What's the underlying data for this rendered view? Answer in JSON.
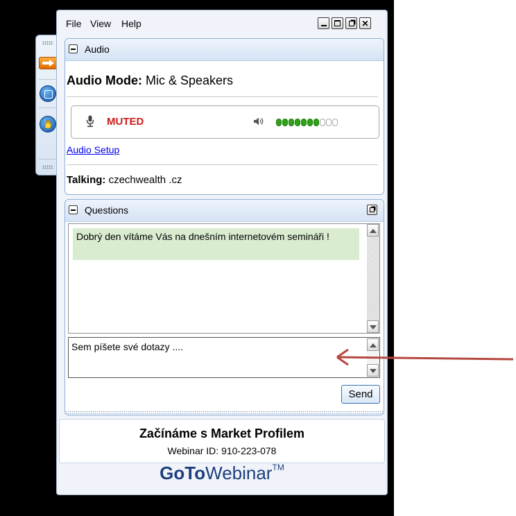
{
  "menu": {
    "file": "File",
    "view": "View",
    "help": "Help"
  },
  "audio": {
    "header": "Audio",
    "mode_label": "Audio Mode:",
    "mode_value": "Mic & Speakers",
    "mic_status": "MUTED",
    "speaker_level": 0.7,
    "speaker_dots_total": 10,
    "setup_link": "Audio Setup",
    "talking_label": "Talking:",
    "talking_value": "czechwealth .cz"
  },
  "questions": {
    "header": "Questions",
    "message": "Dobrý den vítáme Vás na dnešním internetovém semináři !",
    "input_value": "Sem píšete své dotazy ....",
    "send_label": "Send"
  },
  "webinar": {
    "title": "Začínáme s Market Profilem",
    "id_text": "Webinar ID: 910-223-078",
    "logo_bold": "GoTo",
    "logo_rest": "Webinar",
    "logo_tm": "TM"
  },
  "colors": {
    "muted": "#cc1d1d",
    "meter_on": "#2fa316",
    "message_bg": "#d9ecd0",
    "annotation_arrow": "#b5473f"
  }
}
